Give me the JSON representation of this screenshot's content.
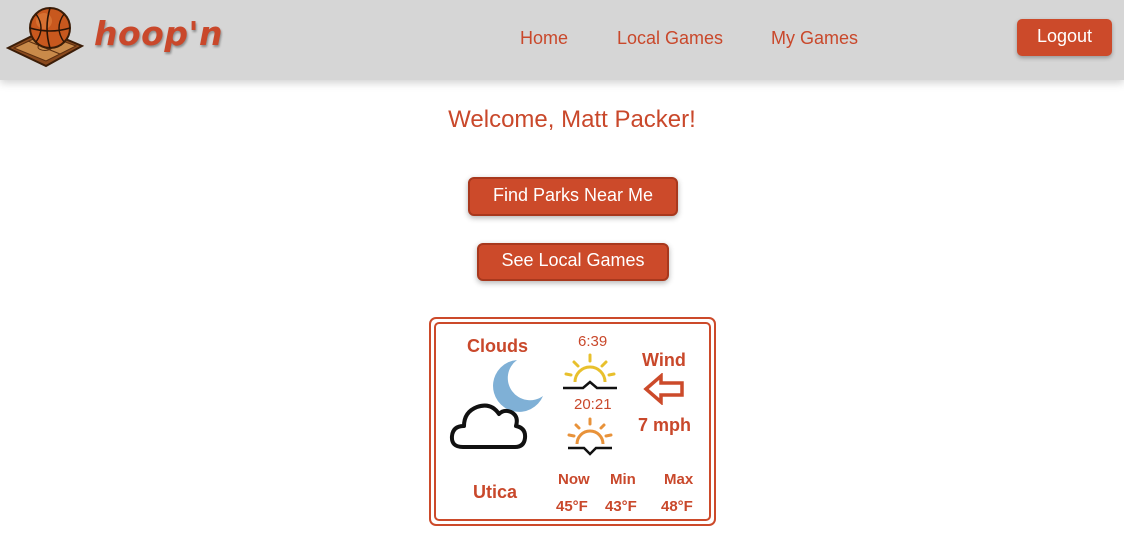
{
  "header": {
    "brand": "hoop'n",
    "nav": {
      "home": "Home",
      "local_games": "Local Games",
      "my_games": "My Games"
    },
    "logout_label": "Logout"
  },
  "main": {
    "welcome": "Welcome, Matt Packer!",
    "find_parks_label": "Find Parks Near Me",
    "see_local_games_label": "See Local Games"
  },
  "weather": {
    "condition": "Clouds",
    "city": "Utica",
    "sunrise": "6:39",
    "sunset": "20:21",
    "wind_label": "Wind",
    "wind_speed": "7 mph",
    "now_label": "Now",
    "min_label": "Min",
    "max_label": "Max",
    "now_temp": "45°F",
    "min_temp": "43°F",
    "max_temp": "48°F",
    "icons": [
      "moon-icon",
      "cloud-icon",
      "sunrise-icon",
      "sunset-icon",
      "wind-arrow-icon"
    ]
  },
  "colors": {
    "accent": "#cc4a2a",
    "navbar": "#d6d6d6",
    "moon": "#7fb0d6",
    "sunrise": "#e8c02c",
    "sunset": "#e8923a"
  }
}
